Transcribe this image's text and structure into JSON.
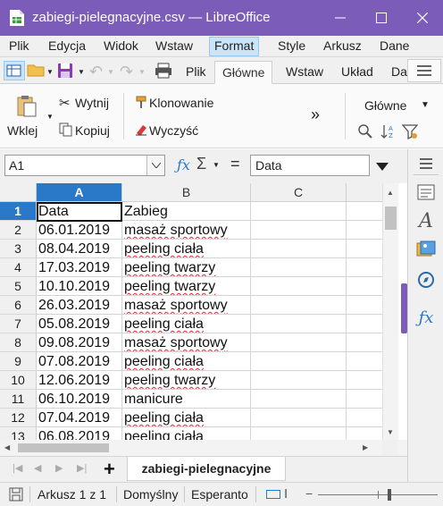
{
  "window": {
    "title": "zabiegi-pielegnacyjne.csv — LibreOffice"
  },
  "menubar": {
    "items": [
      "Plik",
      "Edycja",
      "Widok",
      "Wstaw",
      "Format",
      "Style",
      "Arkusz",
      "Dane"
    ],
    "active": "Format"
  },
  "notebookbar": {
    "tabs": [
      "Plik",
      "Główne",
      "Wstaw",
      "Układ",
      "Da"
    ],
    "active_tab": "Główne"
  },
  "ribbon": {
    "paste": "Wklej",
    "cut": "Wytnij",
    "copy": "Kopiuj",
    "clone": "Klonowanie",
    "clear": "Wyczyść",
    "more": "»",
    "style": "Główne"
  },
  "formula": {
    "name_box": "A1",
    "input": "Data"
  },
  "grid": {
    "columns": [
      "A",
      "B",
      "C"
    ],
    "selected_column": "A",
    "selected_row": "1",
    "rows": [
      {
        "n": "1",
        "a": "Data",
        "b": "Zabieg"
      },
      {
        "n": "2",
        "a": "06.01.2019",
        "b": "masaż sportowy"
      },
      {
        "n": "3",
        "a": "08.04.2019",
        "b": "peeling ciała"
      },
      {
        "n": "4",
        "a": "17.03.2019",
        "b": "peeling twarzy"
      },
      {
        "n": "5",
        "a": "10.10.2019",
        "b": "peeling twarzy"
      },
      {
        "n": "6",
        "a": "26.03.2019",
        "b": "masaż sportowy"
      },
      {
        "n": "7",
        "a": "05.08.2019",
        "b": "peeling ciała"
      },
      {
        "n": "8",
        "a": "09.08.2019",
        "b": "masaż sportowy"
      },
      {
        "n": "9",
        "a": "07.08.2019",
        "b": "peeling ciała"
      },
      {
        "n": "10",
        "a": "12.06.2019",
        "b": "peeling twarzy"
      },
      {
        "n": "11",
        "a": "06.10.2019",
        "b": "manicure"
      },
      {
        "n": "12",
        "a": "07.04.2019",
        "b": "peeling ciała"
      },
      {
        "n": "13",
        "a": "06.08.2019",
        "b": "peeling ciała"
      }
    ]
  },
  "sheets": {
    "add": "+",
    "tabs": [
      "zabiegi-pielegnacyjne"
    ]
  },
  "status": {
    "sheet": "Arkusz 1 z 1",
    "style": "Domyślny",
    "language": "Esperanto"
  },
  "colors": {
    "titlebar": "#7b5cb8",
    "selection": "#2a78c8",
    "accent_sidebar": "#7b5cb8"
  }
}
